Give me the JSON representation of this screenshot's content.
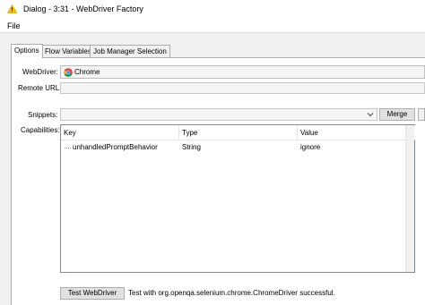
{
  "window": {
    "title": "Dialog - 3:31 - WebDriver Factory",
    "title_icon": "warning-triangle-icon"
  },
  "menu": {
    "file": "File"
  },
  "tabs": [
    {
      "label": "Options",
      "active": true
    },
    {
      "label": "Flow Variables",
      "active": false
    },
    {
      "label": "Job Manager Selection",
      "active": false
    }
  ],
  "form": {
    "webdriver_label": "WebDriver:",
    "webdriver_value": "Chrome",
    "webdriver_icon": "chrome-icon",
    "remote_url_label": "Remote URL:",
    "remote_url_value": "",
    "snippets_label": "Snippets:",
    "snippets_value": "",
    "merge_button": "Merge",
    "capabilities_label": "Capabilities:"
  },
  "capabilities_table": {
    "columns": [
      "Key",
      "Type",
      "Value"
    ],
    "rows": [
      {
        "key": "unhandledPromptBehavior",
        "type": "String",
        "value": "ignore"
      }
    ]
  },
  "footer": {
    "test_button": "Test WebDriver",
    "status_text": "Test with org.openqa.selenium.chrome.ChromeDriver successful."
  },
  "colors": {
    "warning": "#f5c400",
    "window_bg": "#f0f0f0",
    "border": "#adadad"
  }
}
